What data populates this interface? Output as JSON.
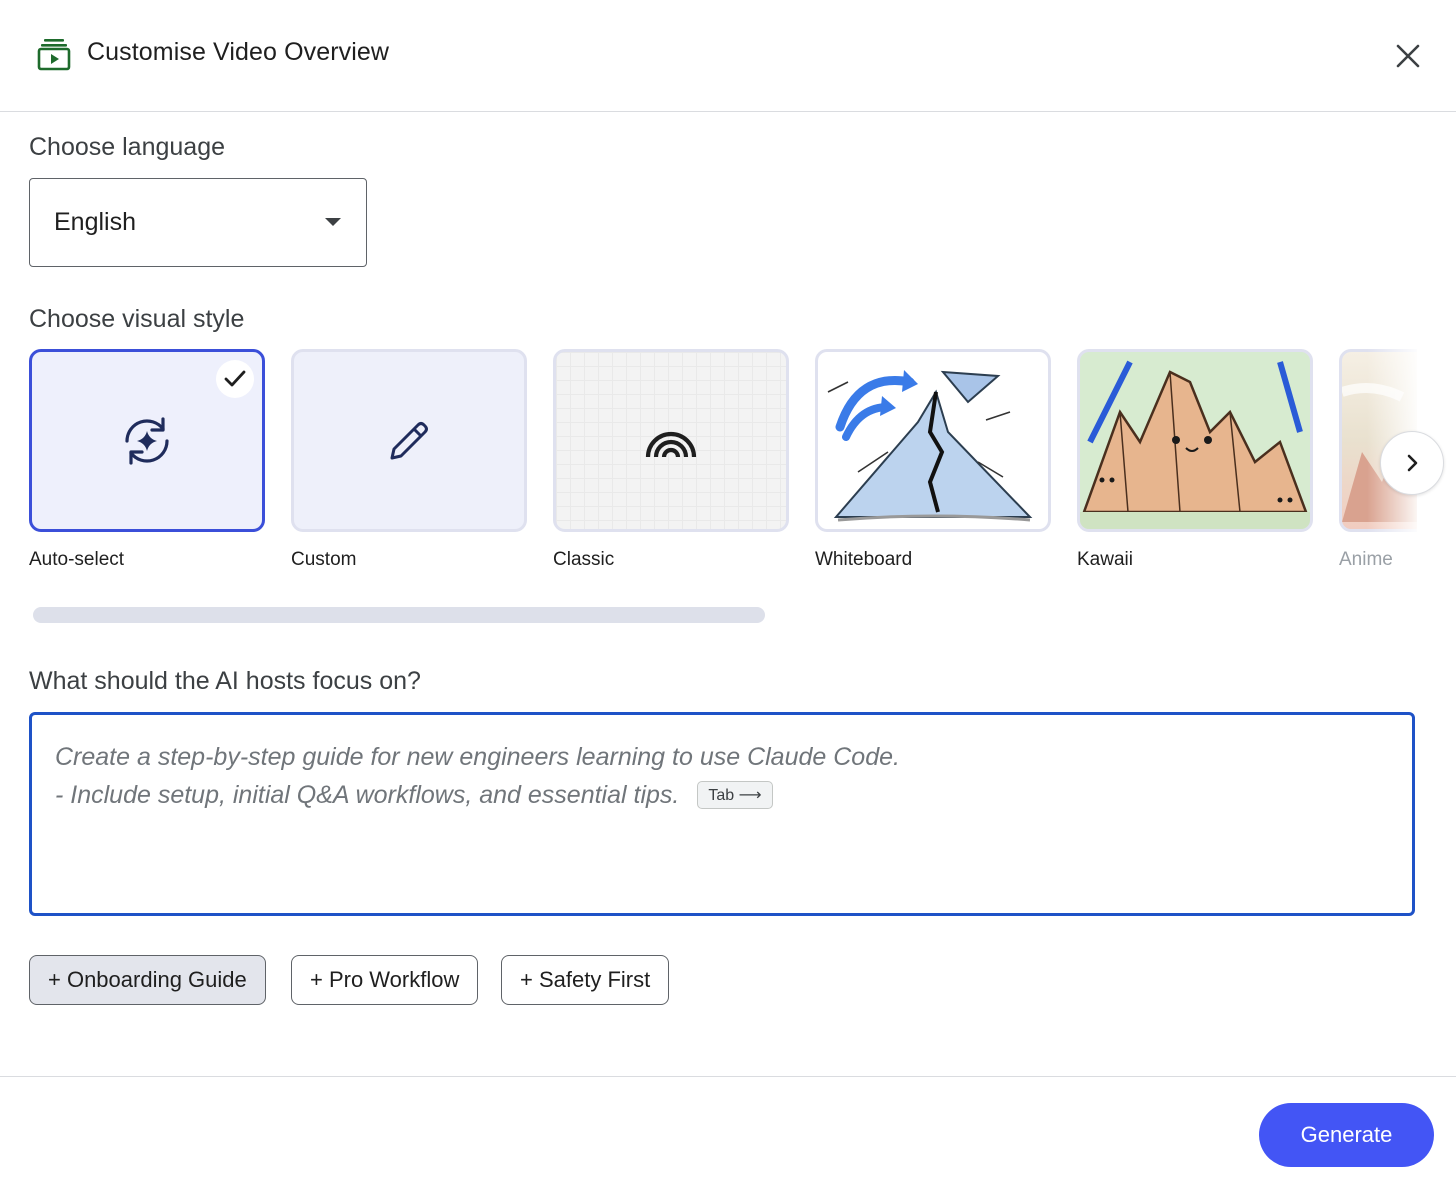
{
  "dialog": {
    "title": "Customise Video Overview",
    "title_icon": "video-overview-icon",
    "close_icon": "close-icon"
  },
  "language": {
    "label": "Choose language",
    "selected": "English"
  },
  "visual_style": {
    "label": "Choose visual style",
    "selected": "Auto-select",
    "styles": [
      {
        "label": "Auto-select",
        "icon": "auto-sparkle-refresh-icon"
      },
      {
        "label": "Custom",
        "icon": "pencil-icon"
      },
      {
        "label": "Classic",
        "icon": "classic-arcs-icon"
      },
      {
        "label": "Whiteboard",
        "icon": "whiteboard-thumbnail"
      },
      {
        "label": "Kawaii",
        "icon": "kawaii-thumbnail"
      },
      {
        "label": "Anime",
        "icon": "anime-thumbnail"
      }
    ],
    "scroll_fraction": 0.55
  },
  "focus": {
    "label": "What should the AI hosts focus on?",
    "placeholder_line1": "Create a step-by-step guide for new engineers learning to use Claude Code.",
    "placeholder_line2": "- Include setup, initial Q&A workflows, and essential tips.",
    "tab_hint": "Tab ⟶"
  },
  "chips": [
    "+ Onboarding Guide",
    "+ Pro Workflow",
    "+ Safety First"
  ],
  "footer": {
    "generate_label": "Generate"
  },
  "colors": {
    "accent": "#3b4fd9",
    "generate": "#4355f5",
    "focus_border": "#1e52c7",
    "header_icon": "#1e6b2c"
  }
}
